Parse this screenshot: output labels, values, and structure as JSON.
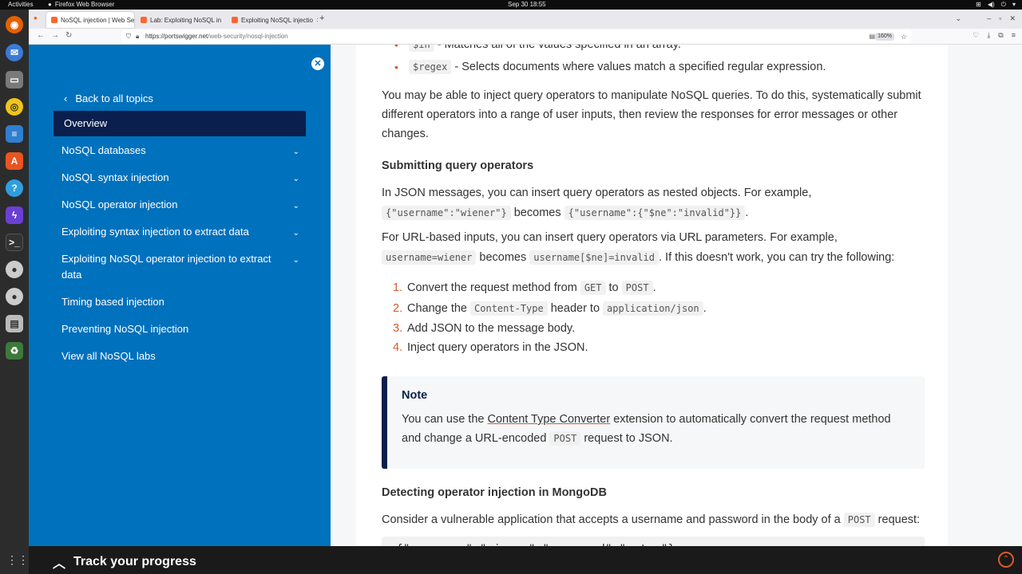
{
  "system": {
    "activities": "Activities",
    "app_name": "Firefox Web Browser",
    "clock": "Sep 30  18:55"
  },
  "browser": {
    "tabs": [
      {
        "label": "NoSQL injection | Web Se"
      },
      {
        "label": "Lab: Exploiting NoSQL in"
      },
      {
        "label": "Exploiting NoSQL injectio"
      }
    ],
    "url_host": "https://portswigger.net",
    "url_path": "/web-security/nosql-injection",
    "zoom": "160%"
  },
  "sidebar": {
    "back_label": "Back to all topics",
    "items": [
      {
        "label": "Overview"
      },
      {
        "label": "NoSQL databases"
      },
      {
        "label": "NoSQL syntax injection"
      },
      {
        "label": "NoSQL operator injection"
      },
      {
        "label": "Exploiting syntax injection to extract data"
      },
      {
        "label": "Exploiting NoSQL operator injection to extract data"
      },
      {
        "label": "Timing based injection"
      },
      {
        "label": "Preventing NoSQL injection"
      },
      {
        "label": "View all NoSQL labs"
      }
    ]
  },
  "content": {
    "op_in_code": "$in",
    "op_in_text": " - Matches all of the values specified in an array.",
    "op_regex_code": "$regex",
    "op_regex_text": " - Selects documents where values match a specified regular expression.",
    "intro_para": "You may be able to inject query operators to manipulate NoSQL queries. To do this, systematically submit different operators into a range of user inputs, then review the responses for error messages or other changes.",
    "h_submitting": "Submitting query operators",
    "json_para_start": "In JSON messages, you can insert query operators as nested objects. For example,",
    "json_code_1": "{\"username\":\"wiener\"}",
    "becomes": " becomes ",
    "json_code_2": "{\"username\":{\"$ne\":\"invalid\"}}",
    "period": ".",
    "url_para_start": "For URL-based inputs, you can insert query operators via URL parameters. For example,",
    "url_code_1": "username=wiener",
    "url_code_2": "username[$ne]=invalid",
    "url_para_end": ". If this doesn't work, you can try the following:",
    "steps": {
      "s1_text": "Convert the request method from ",
      "s1_code_a": "GET",
      "s1_to": " to ",
      "s1_code_b": "POST",
      "s2_text": "Change the ",
      "s2_code_a": "Content-Type",
      "s2_mid": " header to ",
      "s2_code_b": "application/json",
      "s3_text": "Add JSON to the message body.",
      "s4_text": "Inject query operators in the JSON."
    },
    "note": {
      "title": "Note",
      "text_a": "You can use the ",
      "link": "Content Type Converter",
      "text_b": " extension to automatically convert the request method and change a URL-encoded ",
      "code": "POST",
      "text_c": " request to JSON."
    },
    "h_detecting": "Detecting operator injection in MongoDB",
    "detect_para": "Consider a vulnerable application that accepts a username and password in the body of a ",
    "detect_code": "POST",
    "detect_end": " request:",
    "codeblock": "{\"username\":\"wiener\",\"password\":\"peter\"}"
  },
  "progress": {
    "label": "Track your progress"
  },
  "colors": {
    "sidebar_bg": "#0071bc",
    "active_bg": "#0a1f4d",
    "accent": "#d85a2a"
  }
}
